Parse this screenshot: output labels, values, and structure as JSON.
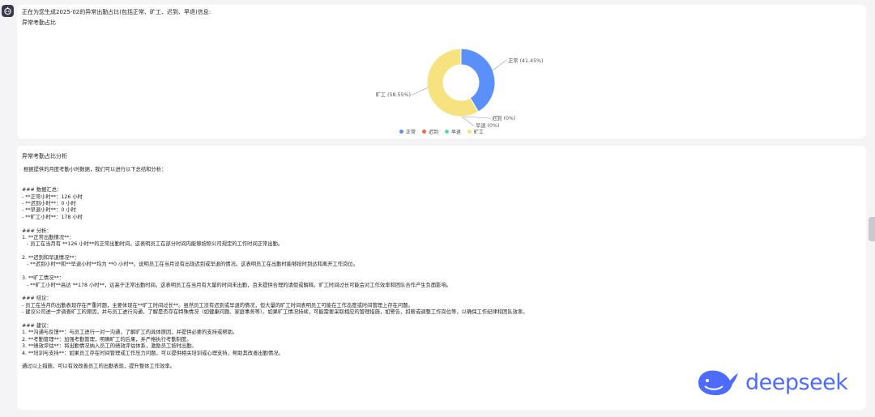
{
  "message": {
    "intro": "正在为您生成2025-02的异常出勤占比(包括正常、旷工、迟到、早退)信息:",
    "chart_card_title": "异常考勤占比"
  },
  "chart_data": {
    "type": "pie",
    "donut": true,
    "title": "异常考勤占比",
    "labels": [
      "正常",
      "迟到",
      "早退",
      "旷工"
    ],
    "values": [
      41.45,
      0,
      0,
      58.55
    ],
    "slice_labels": [
      "正常 (41.45%)",
      "迟到 (0%)",
      "早退 (0%)",
      "旷工 (58.55%)"
    ],
    "colors": [
      "#5b8ff9",
      "#f4664a",
      "#5ad8a6",
      "#f6e27f"
    ],
    "legend_position": "bottom"
  },
  "analysis": {
    "title": "异常考勤占比分析",
    "lines": [
      " 根据提供的月度考勤小时数据，我们可以进行以下总结和分析：",
      "",
      "",
      "### 数据汇总：",
      "- **正常小时**：126 小时",
      "- **迟到小时**：0 小时",
      "- **早退小时**：0 小时",
      "- **旷工小时**：178 小时",
      "",
      "### 分析：",
      "1. **正常出勤情况**：",
      "   - 员工在当月有 **126 小时**的正常出勤时间。这表明员工在部分时间内能够按照公司规定的工作时间正常出勤。",
      "",
      "2. **迟到和早退情况**：",
      "   - **迟到小时**和**早退小时**均为 **0 小时**。说明员工在当月没有出现迟到或早退的情况。这表明员工在出勤时能够按时到达和离开工作岗位。",
      "",
      "3. **旷工情况**：",
      "   - **旷工小时**高达 **178 小时**，远高于正常出勤时间。这表明员工在当月有大量的时间未出勤，且未提供合理的请假或解释。旷工时间过长可能会对工作效率和团队合作产生负面影响。",
      "",
      "### 结论：",
      "- 员工在当月的出勤表现存在严重问题，主要体现在**旷工时间过长**。虽然员工没有迟到或早退的情况，但大量的旷工时间表明员工可能在工作态度或时间管理上存在问题。",
      "- 建议公司进一步调查旷工的原因，并与员工进行沟通，了解是否存在特殊情况（如健康问题、家庭事务等）。如果旷工情况持续，可能需要采取相应的管理措施，如警告、扣薪或调整工作岗位等，以确保工作纪律和团队效率。",
      "",
      "### 建议：",
      "1. **沟通与反馈**：与员工进行一对一沟通，了解旷工的具体原因，并提供必要的支持或帮助。",
      "2. **考勤管理**：加强考勤管理，明确旷工的后果，并严格执行考勤制度。",
      "3. **绩效评估**：将出勤情况纳入员工的绩效评估体系，激励员工按时出勤。",
      "4. **培训与支持**：如果员工存在时间管理或工作压力问题，可以提供相关培训或心理支持，帮助其改善出勤情况。",
      "",
      "通过以上措施，可以有效改善员工的出勤表现，提升整体工作效率。"
    ]
  },
  "brand": {
    "logo_text": "deepseek"
  }
}
